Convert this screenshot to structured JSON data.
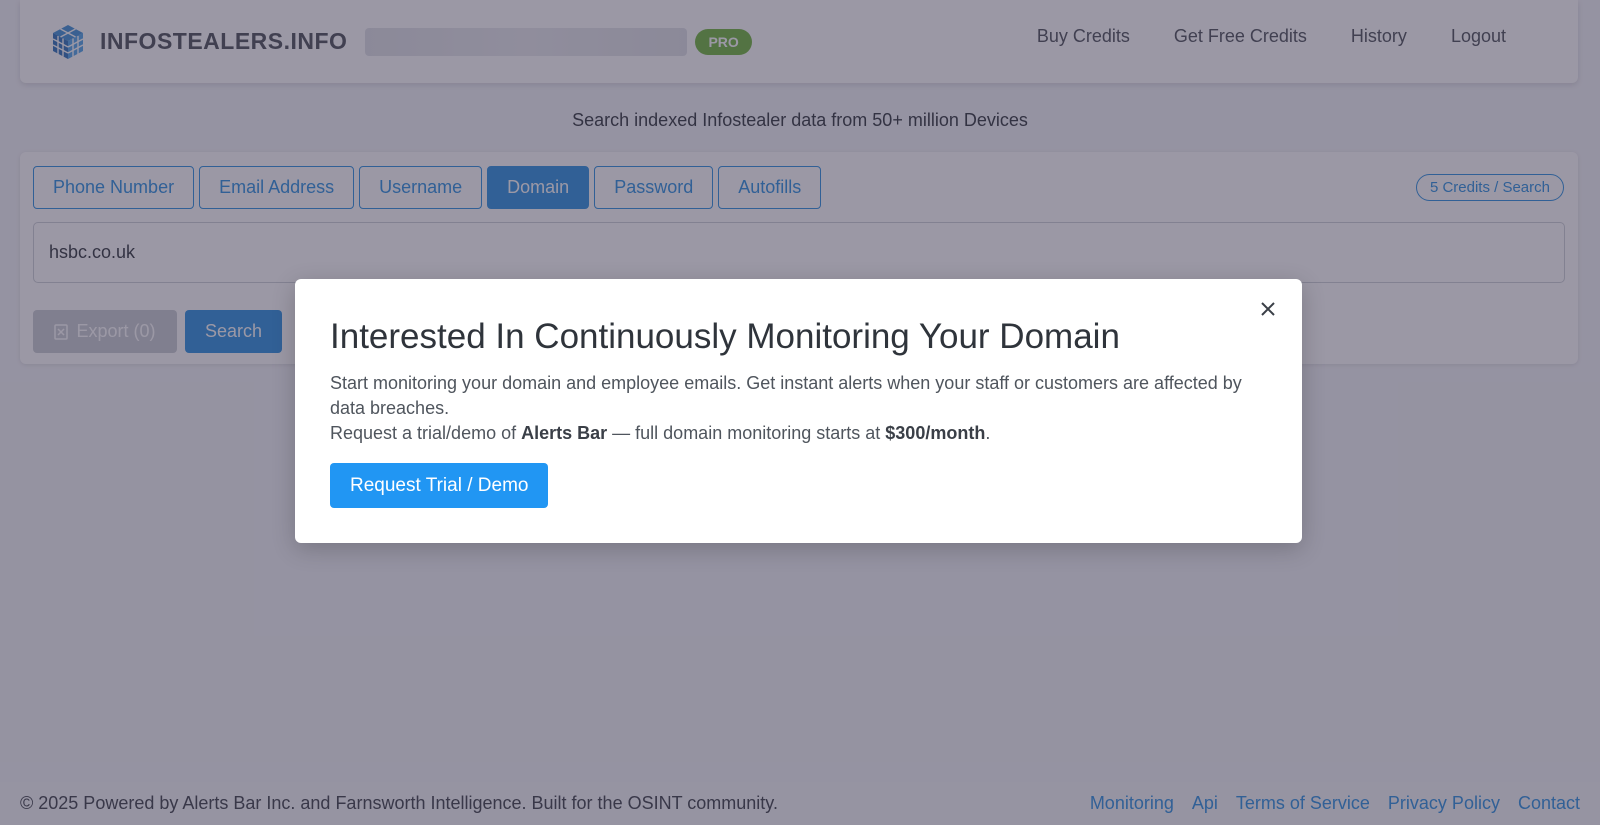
{
  "brand": {
    "name": "INFOSTEALERS.INFO",
    "badge": "PRO",
    "logo_icon": "cube-grid-icon",
    "accent_color": "#2b8fe0"
  },
  "nav": {
    "links": [
      "Buy Credits",
      "Get Free Credits",
      "History",
      "Logout"
    ]
  },
  "tagline": "Search indexed Infostealer data from 50+ million Devices",
  "search": {
    "tabs": [
      "Phone Number",
      "Email Address",
      "Username",
      "Domain",
      "Password",
      "Autofills"
    ],
    "active_tab": "Domain",
    "credits_badge": "5 Credits / Search",
    "query_value": "hsbc.co.uk",
    "export_label": "Export (0)",
    "search_label": "Search"
  },
  "modal": {
    "title": "Interested In Continuously Monitoring Your Domain",
    "line1": "Start monitoring your domain and employee emails. Get instant alerts when your staff or customers are affected by data breaches.",
    "line2_prefix": "Request a trial/demo of ",
    "line2_product": "Alerts Bar",
    "line2_middle": " — full domain monitoring starts at ",
    "line2_price": "$300/month",
    "line2_suffix": ".",
    "cta_label": "Request Trial / Demo",
    "close_icon": "close-icon"
  },
  "footer": {
    "copyright": "© 2025 Powered by Alerts Bar Inc. and Farnsworth Intelligence. Built for the OSINT community.",
    "links": [
      "Monitoring",
      "Api",
      "Terms of Service",
      "Privacy Policy",
      "Contact"
    ]
  }
}
